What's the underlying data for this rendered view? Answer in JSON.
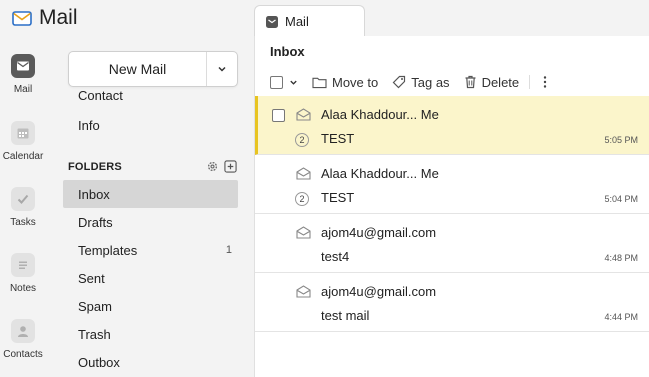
{
  "app": {
    "title": "Mail"
  },
  "rail": [
    {
      "label": "Mail",
      "icon": "mail-icon"
    },
    {
      "label": "Calendar",
      "icon": "calendar-icon"
    },
    {
      "label": "Tasks",
      "icon": "tasks-icon"
    },
    {
      "label": "Notes",
      "icon": "notes-icon"
    },
    {
      "label": "Contacts",
      "icon": "contacts-icon"
    }
  ],
  "sidebar": {
    "new_mail_label": "New Mail",
    "links": [
      "Contact",
      "Info"
    ],
    "folders_header": "FOLDERS",
    "folders": [
      {
        "label": "Inbox",
        "count": ""
      },
      {
        "label": "Drafts",
        "count": ""
      },
      {
        "label": "Templates",
        "count": "1"
      },
      {
        "label": "Sent",
        "count": ""
      },
      {
        "label": "Spam",
        "count": ""
      },
      {
        "label": "Trash",
        "count": ""
      },
      {
        "label": "Outbox",
        "count": ""
      }
    ]
  },
  "tab": {
    "label": "Mail"
  },
  "main": {
    "title": "Inbox",
    "toolbar": {
      "move_label": "Move to",
      "tag_label": "Tag as",
      "delete_label": "Delete"
    },
    "messages": [
      {
        "sender": "Alaa Khaddour... Me",
        "thread_count": "2",
        "subject": "TEST",
        "time": "5:05 PM"
      },
      {
        "sender": "Alaa Khaddour... Me",
        "thread_count": "2",
        "subject": "TEST",
        "time": "5:04 PM"
      },
      {
        "sender": "ajom4u@gmail.com",
        "thread_count": "",
        "subject": "test4",
        "time": "4:48 PM"
      },
      {
        "sender": "ajom4u@gmail.com",
        "thread_count": "",
        "subject": "test mail",
        "time": "4:44 PM"
      }
    ]
  },
  "colors": {
    "selected_row_bg": "#fbf5cb",
    "selected_row_accent": "#e8c421",
    "selected_folder_bg": "#d6d6d6",
    "active_rail_icon": "#5a5a5a"
  }
}
